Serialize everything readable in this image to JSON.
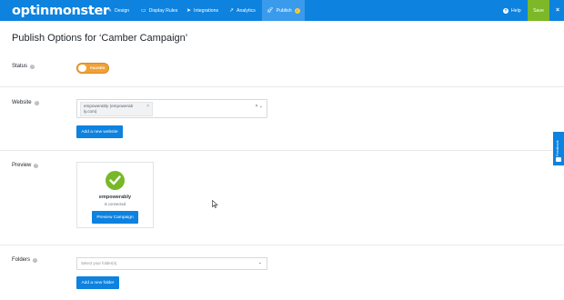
{
  "app": {
    "logo_text": "optinmonster"
  },
  "nav": {
    "items": [
      {
        "label": "Design",
        "icon": "pencil-icon"
      },
      {
        "label": "Display Rules",
        "icon": "monitor-icon"
      },
      {
        "label": "Integrations",
        "icon": "send-icon"
      },
      {
        "label": "Analytics",
        "icon": "chart-line-icon"
      },
      {
        "label": "Publish",
        "icon": "rocket-icon",
        "active": true,
        "badge": "✓"
      }
    ],
    "help_label": "Help",
    "save_label": "Save",
    "close_glyph": "×"
  },
  "page": {
    "title": "Publish Options for ‘Camber Campaign’"
  },
  "status": {
    "label": "Status",
    "toggle_text": "PAUSED",
    "state": "paused"
  },
  "website": {
    "label": "Website",
    "selected_chip": "empowerably (empowerably.com)",
    "chip_line1": "empowerably (empowerab",
    "chip_line2": "ly.com)",
    "add_button": "Add a new website"
  },
  "preview": {
    "label": "Preview",
    "site_name": "empowerably",
    "site_status": "is connected",
    "button": "Preview Campaign"
  },
  "folders": {
    "label": "Folders",
    "placeholder": "Select your folder(s)",
    "add_button": "Add a new folder"
  },
  "feedback": {
    "label": "Feedback"
  },
  "colors": {
    "brand_blue": "#0d82df",
    "save_green": "#7cb828",
    "toggle_orange": "#f0a136",
    "check_green": "#77b828"
  }
}
